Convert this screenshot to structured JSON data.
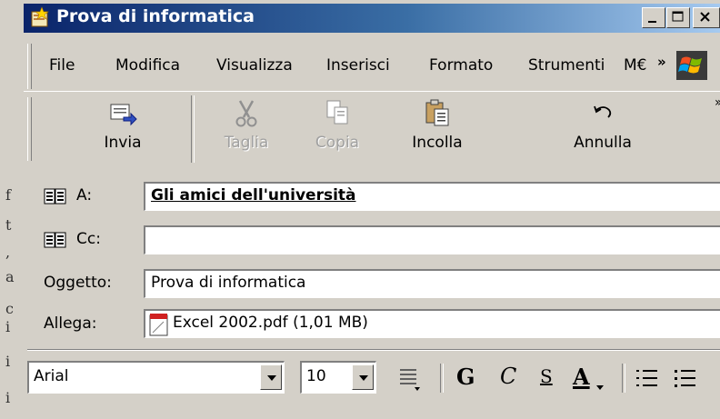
{
  "window": {
    "title": "Prova di informatica"
  },
  "background_window_chars": [
    "f",
    "t",
    ",",
    "a",
    "c",
    "i",
    "i",
    "i"
  ],
  "menu": [
    {
      "label": "File",
      "accel": "F"
    },
    {
      "label": "Modifica",
      "accel": "o"
    },
    {
      "label": "Visualizza",
      "accel": "V"
    },
    {
      "label": "Inserisci",
      "accel": "I"
    },
    {
      "label": "Formato",
      "accel": "r"
    },
    {
      "label": "Strumenti",
      "accel": "S"
    },
    {
      "label": "M€",
      "accel": ""
    }
  ],
  "menu_overflow": "»",
  "toolbar": {
    "send": "Invia",
    "cut": "Taglia",
    "copy": "Copia",
    "paste": "Incolla",
    "undo": "Annulla"
  },
  "fields": {
    "to_label": "A:",
    "to_value": "Gli amici dell'università",
    "cc_label": "Cc:",
    "cc_value": "",
    "subject_label": "Oggetto:",
    "subject_value": "Prova di informatica",
    "attach_label": "Allega:",
    "attach_value": "Excel 2002.pdf (1,01 MB)"
  },
  "format": {
    "font": "Arial",
    "size": "10",
    "bold": "G",
    "italic": "C",
    "underline": "S",
    "color": "A"
  },
  "colors": {
    "titlebar_start": "#0a246a",
    "titlebar_end": "#a6caf0",
    "chrome": "#d4d0c8"
  }
}
